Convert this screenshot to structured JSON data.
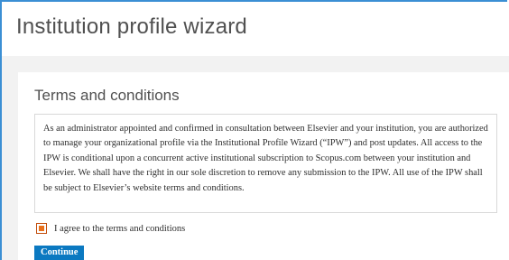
{
  "app": {
    "title": "Institution profile wizard"
  },
  "terms": {
    "heading": "Terms and conditions",
    "body": "As an administrator appointed and confirmed in consultation between Elsevier and your institution, you are authorized to manage your organizational profile via the Institutional Profile Wizard (“IPW”) and post updates. All access to the IPW is conditional upon a concurrent active institutional subscription to Scopus.com between your institution and Elsevier. We shall have the right in our sole discretion to remove any submission to the IPW. All use of the IPW shall be subject to Elsevier’s website terms and conditions."
  },
  "agreement": {
    "label": "I agree to the terms and conditions",
    "checked": true
  },
  "actions": {
    "continue_label": "Continue"
  },
  "colors": {
    "frame_border": "#3b8fd4",
    "checkbox_accent": "#e9711c",
    "button_background": "#0b79c1",
    "page_background": "#f2f2f2"
  }
}
